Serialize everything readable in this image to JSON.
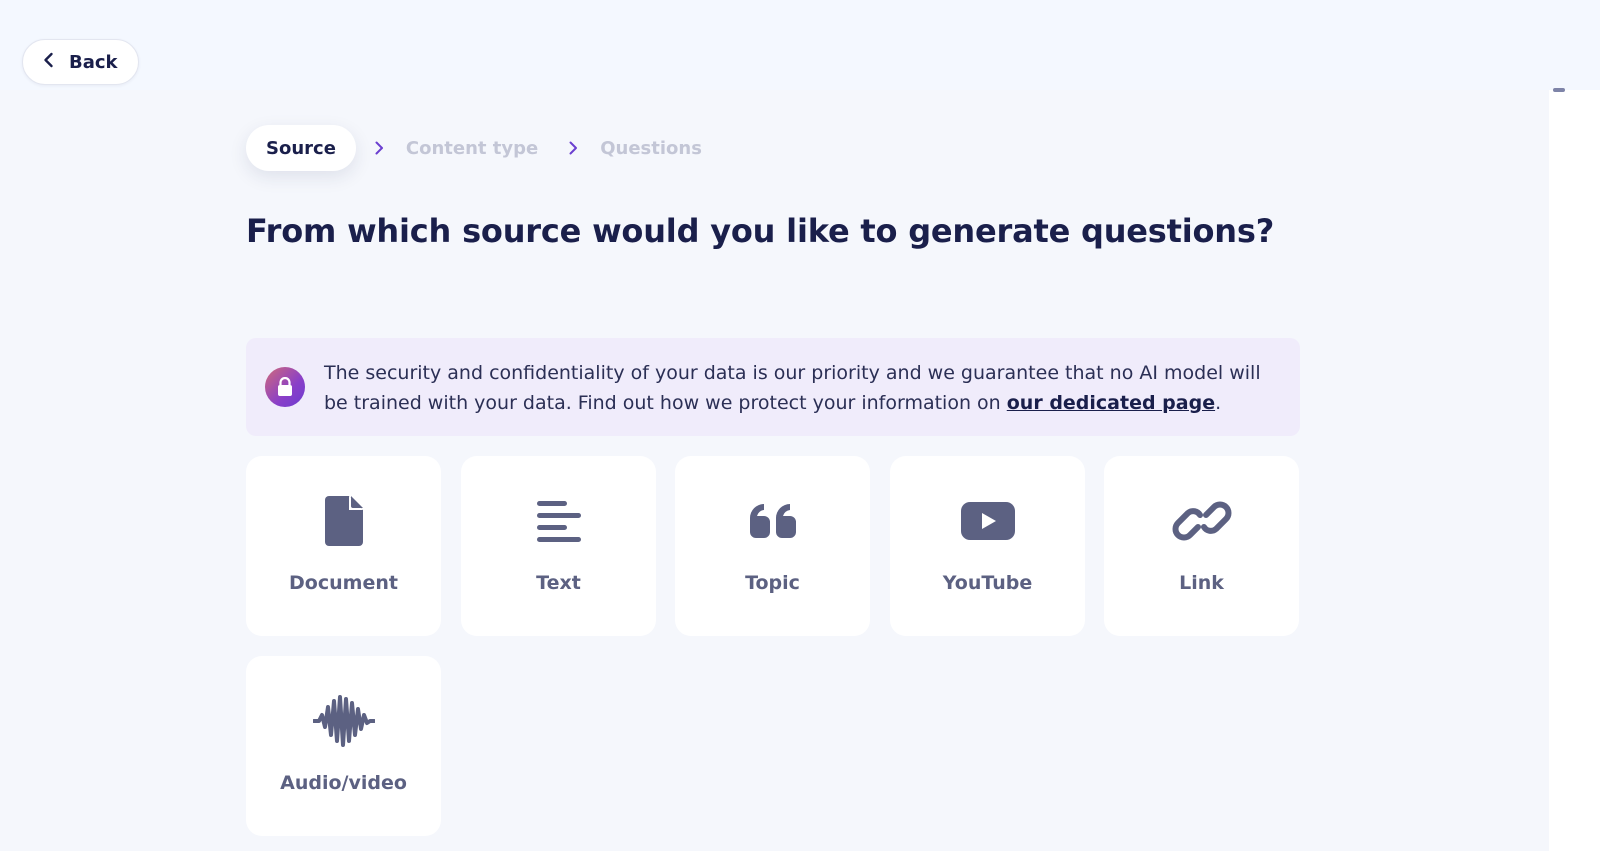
{
  "header": {
    "back_label": "Back"
  },
  "steps": [
    {
      "label": "Source",
      "active": true
    },
    {
      "label": "Content type",
      "active": false
    },
    {
      "label": "Questions",
      "active": false
    }
  ],
  "title": "From which source would you like to generate questions?",
  "notice": {
    "text_before": "The security and confidentiality of your data is our priority and we guarantee that no AI model will be trained with your data. Find out how we protect your information on ",
    "link_text": "our dedicated page",
    "text_after": "."
  },
  "sources": [
    {
      "label": "Document",
      "icon": "document-icon"
    },
    {
      "label": "Text",
      "icon": "text-lines-icon"
    },
    {
      "label": "Topic",
      "icon": "quote-icon"
    },
    {
      "label": "YouTube",
      "icon": "youtube-icon"
    },
    {
      "label": "Link",
      "icon": "link-icon"
    },
    {
      "label": "Audio/video",
      "icon": "audio-wave-icon"
    }
  ],
  "colors": {
    "primary_text": "#1a1f4b",
    "icon": "#5c6182",
    "inactive_step": "#c3c6d6",
    "notice_bg": "#f0ecfb",
    "chevron": "#6b3fd0"
  }
}
